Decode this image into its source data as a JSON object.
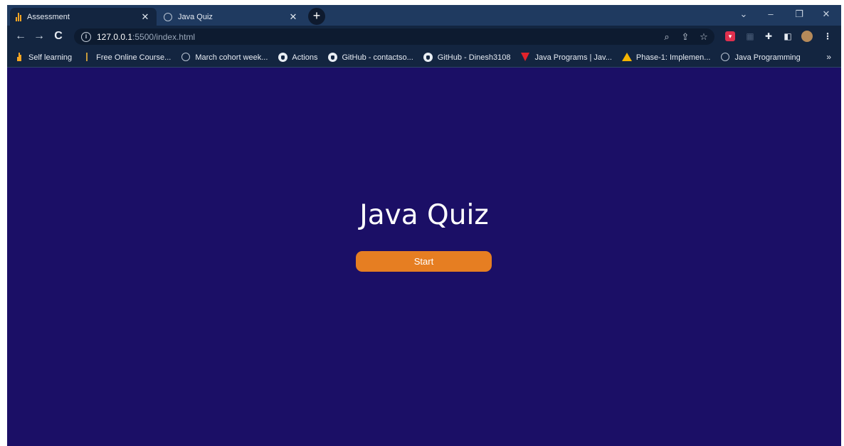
{
  "browser": {
    "tabs": [
      {
        "title": "Assessment",
        "icon": "brand-bars-icon",
        "active": true
      },
      {
        "title": "Java Quiz",
        "icon": "globe-icon",
        "active": false
      }
    ],
    "address": {
      "host": "127.0.0.1",
      "path": ":5500/index.html"
    },
    "bookmarks": [
      {
        "label": "Self learning",
        "icon": "brand-bars-icon"
      },
      {
        "label": "Free Online Course...",
        "icon": "brand-bars-icon"
      },
      {
        "label": "March cohort week...",
        "icon": "globe-icon"
      },
      {
        "label": "Actions",
        "icon": "github-icon"
      },
      {
        "label": "GitHub - contactso...",
        "icon": "github-icon"
      },
      {
        "label": "GitHub - Dinesh3108",
        "icon": "github-icon"
      },
      {
        "label": "Java Programs | Jav...",
        "icon": "v-logo-icon"
      },
      {
        "label": "Phase-1: Implemen...",
        "icon": "drive-icon"
      },
      {
        "label": "Java Programming",
        "icon": "globe-icon"
      }
    ],
    "bookmarks_more": "»"
  },
  "page": {
    "title": "Java Quiz",
    "start_label": "Start",
    "background_color": "#1b0f66",
    "button_color": "#e67e22"
  }
}
